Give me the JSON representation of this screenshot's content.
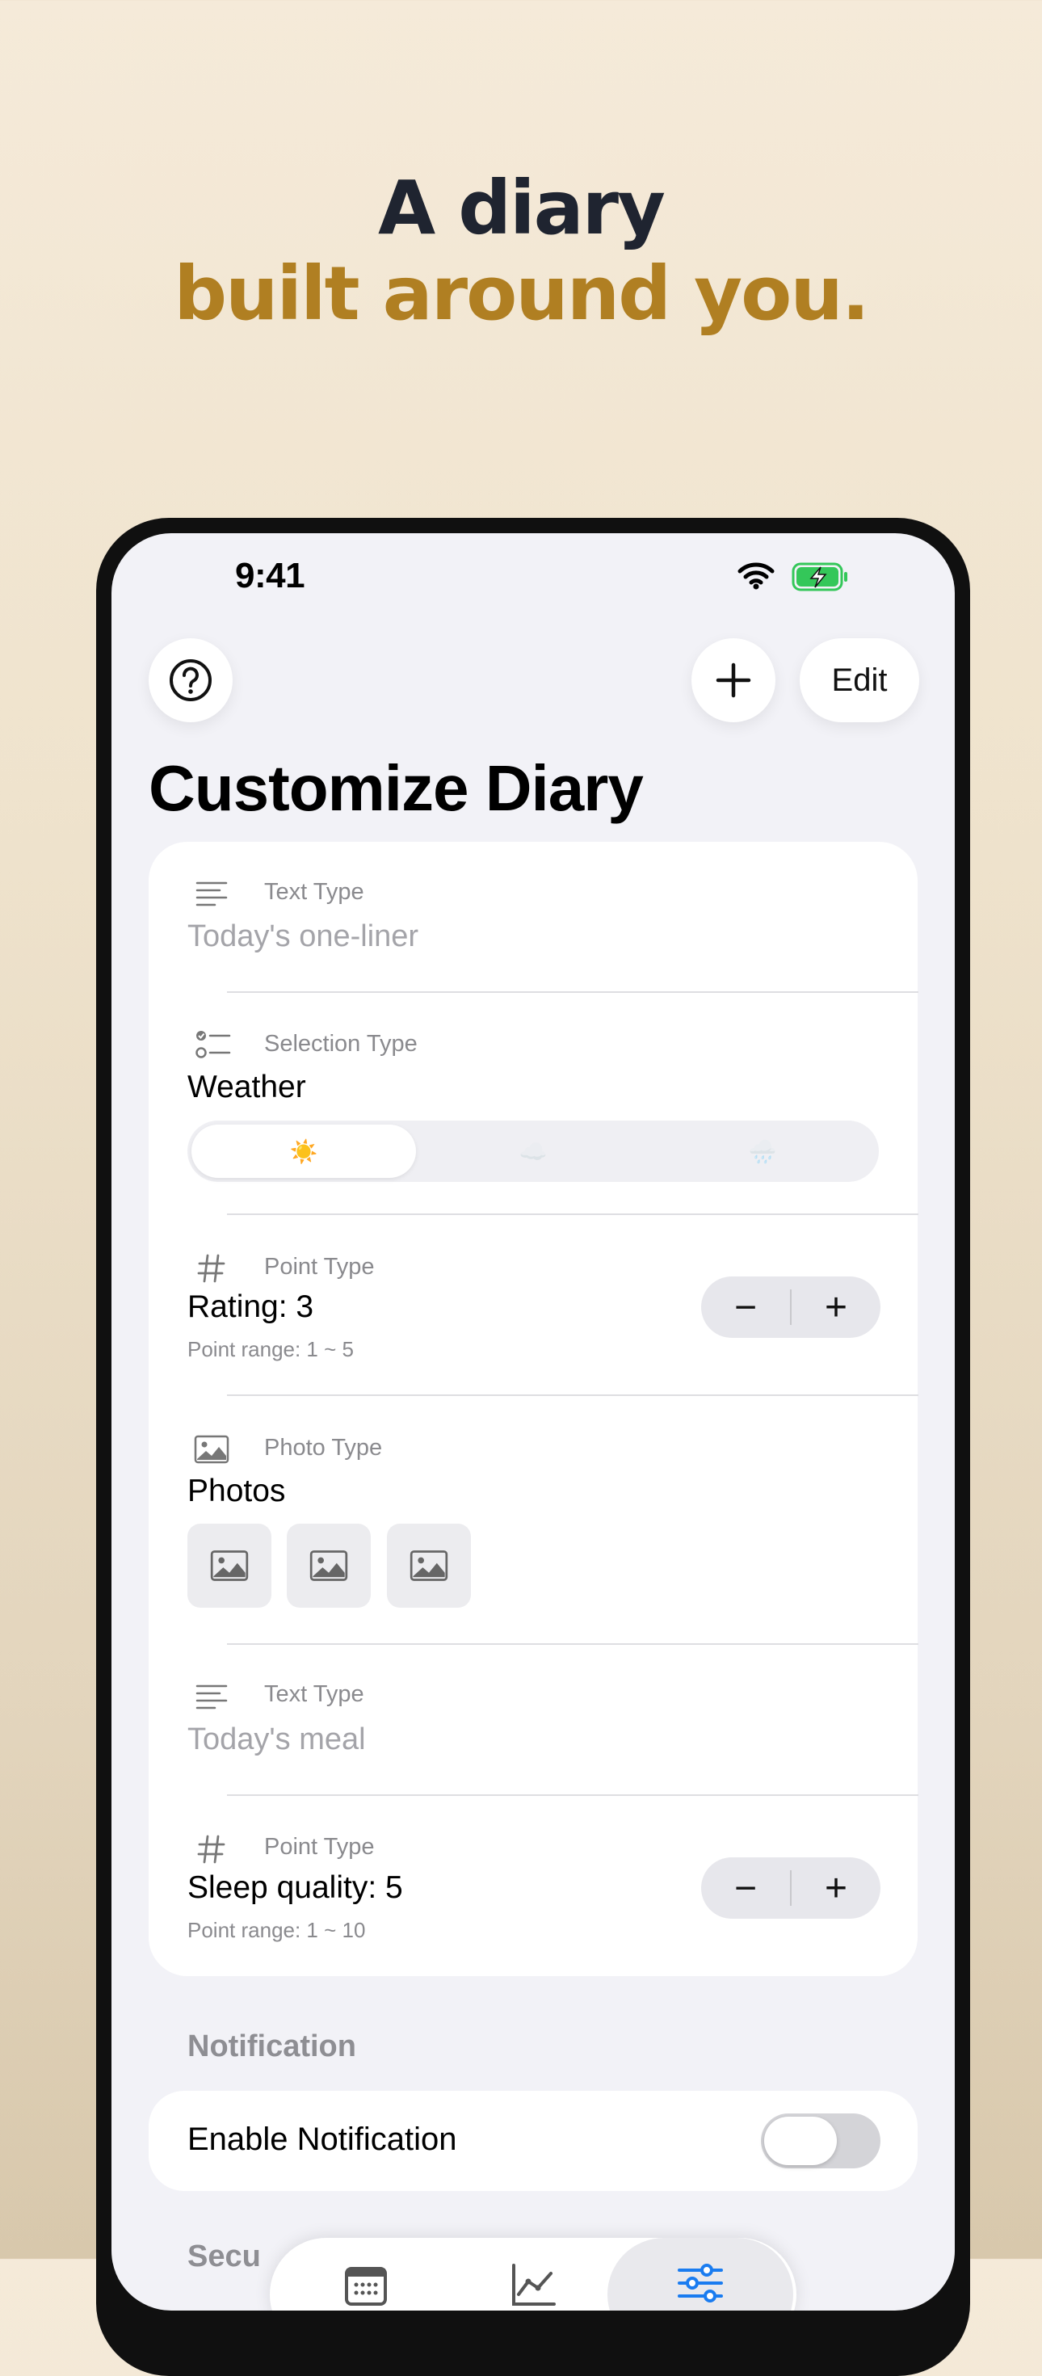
{
  "headline": {
    "line1": "A diary",
    "line2": "built around you."
  },
  "status_bar": {
    "time": "9:41",
    "icons": [
      "wifi-icon",
      "battery-charging-icon"
    ]
  },
  "toolbar": {
    "help_icon": "question-circle-icon",
    "add_icon": "plus-icon",
    "edit_label": "Edit"
  },
  "page": {
    "title": "Customize Diary"
  },
  "items": [
    {
      "type_label": "Text Type",
      "icon": "text-lines-icon",
      "placeholder": "Today's one-liner"
    },
    {
      "type_label": "Selection Type",
      "icon": "checklist-icon",
      "title": "Weather",
      "options": [
        "☀️",
        "☁️",
        "🌧️"
      ],
      "selected_index": 0
    },
    {
      "type_label": "Point Type",
      "icon": "hash-icon",
      "title": "Rating: 3",
      "range": "Point range: 1 ~ 5",
      "value": 3
    },
    {
      "type_label": "Photo Type",
      "icon": "photo-icon",
      "title": "Photos",
      "photo_slots": 3
    },
    {
      "type_label": "Text Type",
      "icon": "text-lines-icon",
      "placeholder": "Today's meal"
    },
    {
      "type_label": "Point Type",
      "icon": "hash-icon",
      "title": "Sleep quality: 5",
      "range": "Point range: 1 ~ 10",
      "value": 5
    }
  ],
  "stepper": {
    "minus": "−",
    "plus": "+"
  },
  "notification": {
    "section_title": "Notification",
    "label": "Enable Notification",
    "enabled": false
  },
  "next_section_peek": "Secu",
  "tabbar": {
    "tabs": [
      {
        "icon": "calendar-icon",
        "active": false
      },
      {
        "icon": "chart-line-icon",
        "active": false
      },
      {
        "icon": "sliders-icon",
        "active": true
      }
    ]
  },
  "colors": {
    "headline_dark": "#1f2430",
    "headline_accent": "#b07f22",
    "active_tab": "#1a7cf0",
    "battery_green": "#34c759"
  }
}
